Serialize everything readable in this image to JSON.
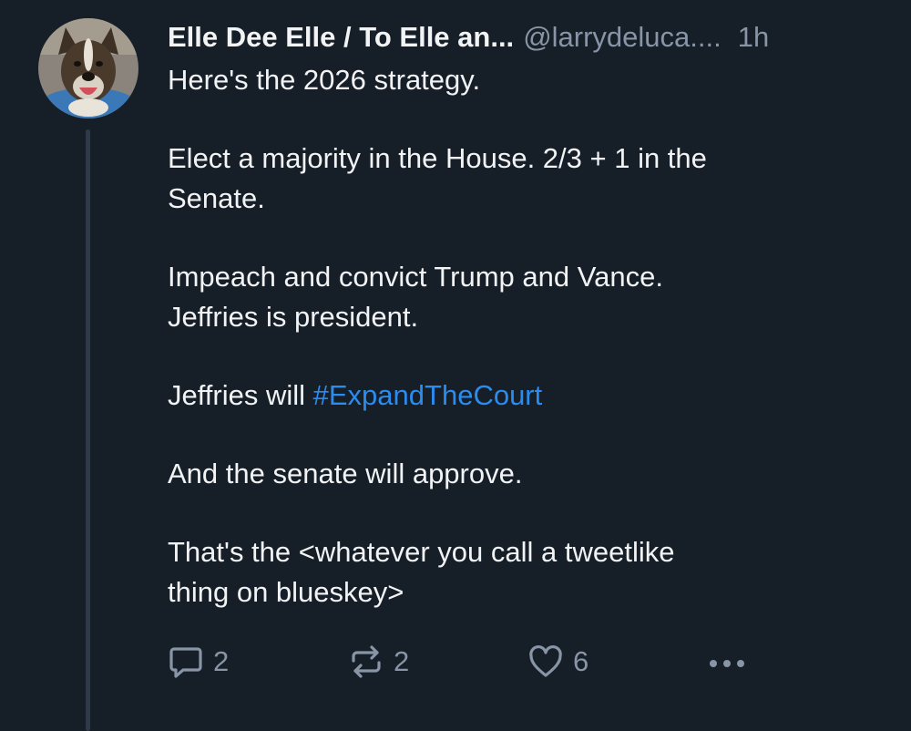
{
  "post": {
    "author": "Elle Dee Elle / To Elle an...",
    "handle": "@larrydeluca....",
    "time": "1h",
    "body": {
      "line1": "Here's the 2026 strategy.",
      "line2a": "Elect a majority in the House.  2/3 + 1 in the",
      "line2b": "Senate.",
      "line3a": "Impeach and convict Trump and Vance.",
      "line3b": "Jeffries is president.",
      "line4_prefix": "Jeffries will ",
      "line4_hashtag": "#ExpandTheCourt",
      "line5": "And the senate will approve.",
      "line6a": "That's the <whatever you call a tweetlike",
      "line6b": "thing on blueskey>"
    },
    "actions": {
      "reply_count": "2",
      "repost_count": "2",
      "like_count": "6"
    }
  },
  "icons": {
    "reply": "speech-bubble-icon",
    "repost": "repost-arrows-icon",
    "like": "heart-icon",
    "more": "ellipsis-icon"
  },
  "colors": {
    "background": "#161e27",
    "text": "#f1f3f5",
    "muted": "#8795a6",
    "link": "#2b8cf0",
    "thread_line": "#2e3a48"
  }
}
